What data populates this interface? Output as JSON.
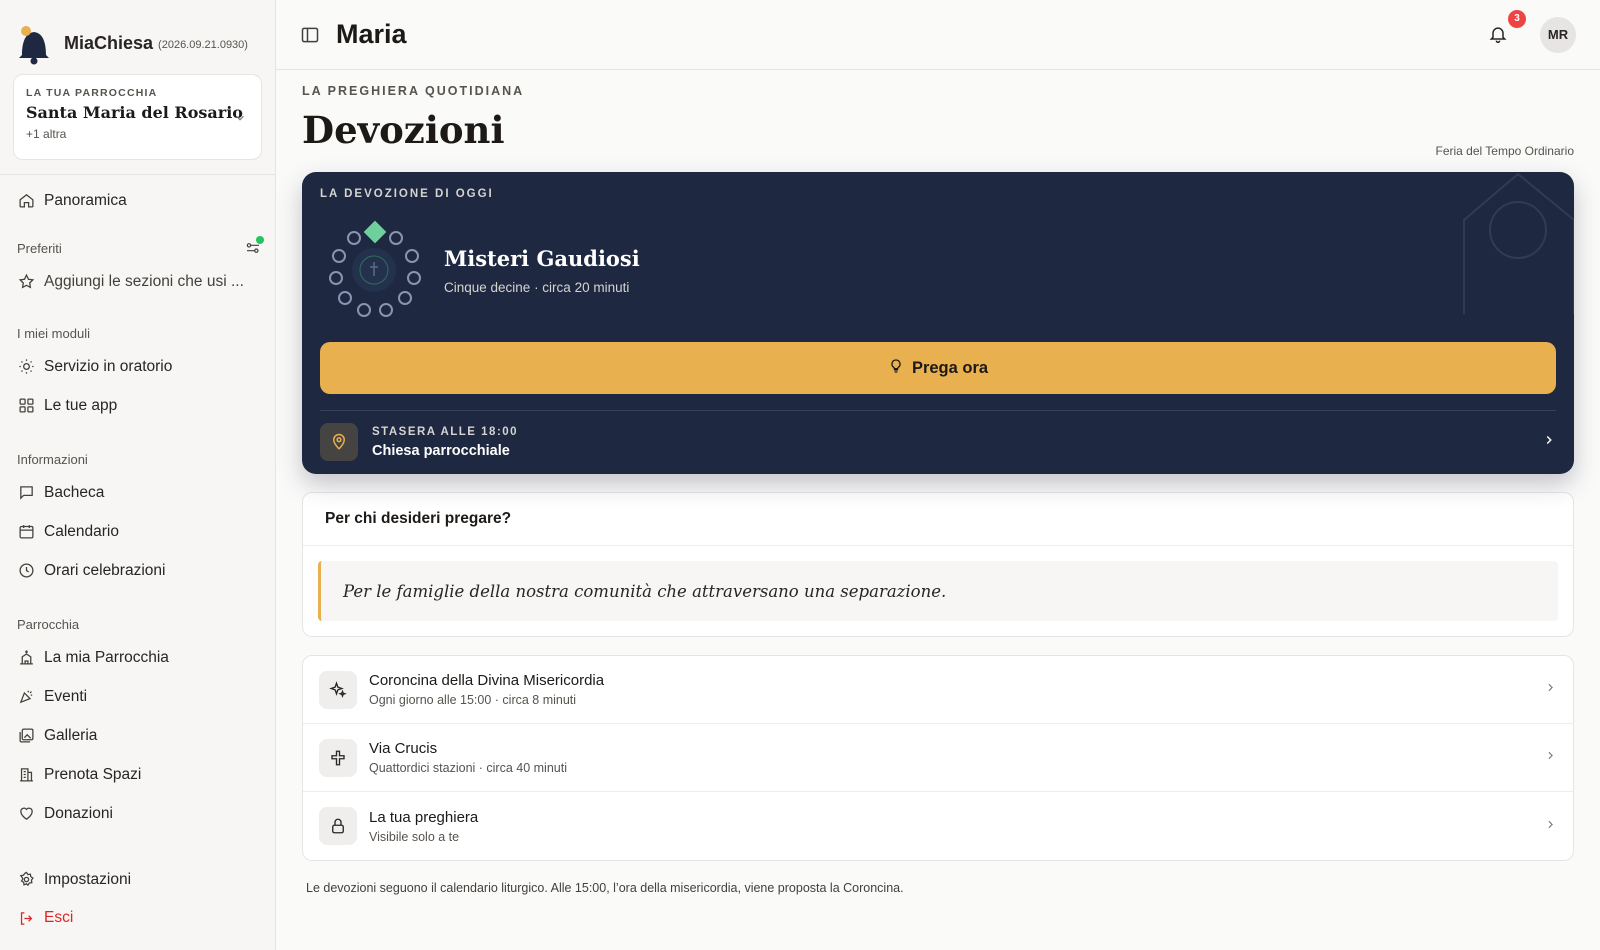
{
  "app": {
    "name": "MiaChiesa",
    "version": "(2026.09.21.0930)"
  },
  "parish": {
    "kicker": "LA TUA PARROCCHIA",
    "name": "Santa Maria del Rosario",
    "more": "+1 altra"
  },
  "sidebar": {
    "overview": "Panoramica",
    "favorites_title": "Preferiti",
    "favorites_add": "Aggiungi le sezioni che usi ...",
    "modules_title": "I miei moduli",
    "modules": [
      "Servizio in oratorio",
      "Le tue app"
    ],
    "info_title": "Informazioni",
    "info": [
      "Bacheca",
      "Calendario",
      "Orari celebrazioni"
    ],
    "parish_title": "Parrocchia",
    "parish_items": [
      "La mia Parrocchia",
      "Eventi",
      "Galleria",
      "Prenota Spazi",
      "Donazioni"
    ],
    "settings": "Impostazioni",
    "logout": "Esci"
  },
  "topbar": {
    "title": "Maria",
    "notifications": "3",
    "avatar": "MR"
  },
  "page": {
    "kicker": "LA PREGHIERA QUOTIDIANA",
    "title": "Devozioni",
    "liturgy": "Feria del Tempo Ordinario"
  },
  "hero": {
    "kicker": "LA DEVOZIONE DI OGGI",
    "title": "Misteri Gaudiosi",
    "subtitle": "Cinque decine · circa 20 minuti",
    "button": "Prega ora",
    "evening_kicker": "STASERA ALLE 18:00",
    "evening_place": "Chiesa parrocchiale"
  },
  "intention": {
    "question": "Per chi desideri pregare?",
    "text": "Per le famiglie della nostra comunità che attraversano una separazione."
  },
  "devotions": [
    {
      "title": "Coroncina della Divina Misericordia",
      "subtitle": "Ogni giorno alle 15:00 · circa 8 minuti",
      "icon": "sparkles-icon"
    },
    {
      "title": "Via Crucis",
      "subtitle": "Quattordici stazioni · circa 40 minuti",
      "icon": "cross-icon"
    },
    {
      "title": "La tua preghiera",
      "subtitle": "Visibile solo a te",
      "icon": "lock-icon"
    }
  ],
  "footnote": "Le devozioni seguono il calendario liturgico. Alle 15:00, l’ora della misericordia, viene proposta la Coroncina.",
  "colors": {
    "accent": "#e8b04e",
    "hero": "#1e2840",
    "danger": "#dc2626",
    "online": "#22c55e"
  }
}
